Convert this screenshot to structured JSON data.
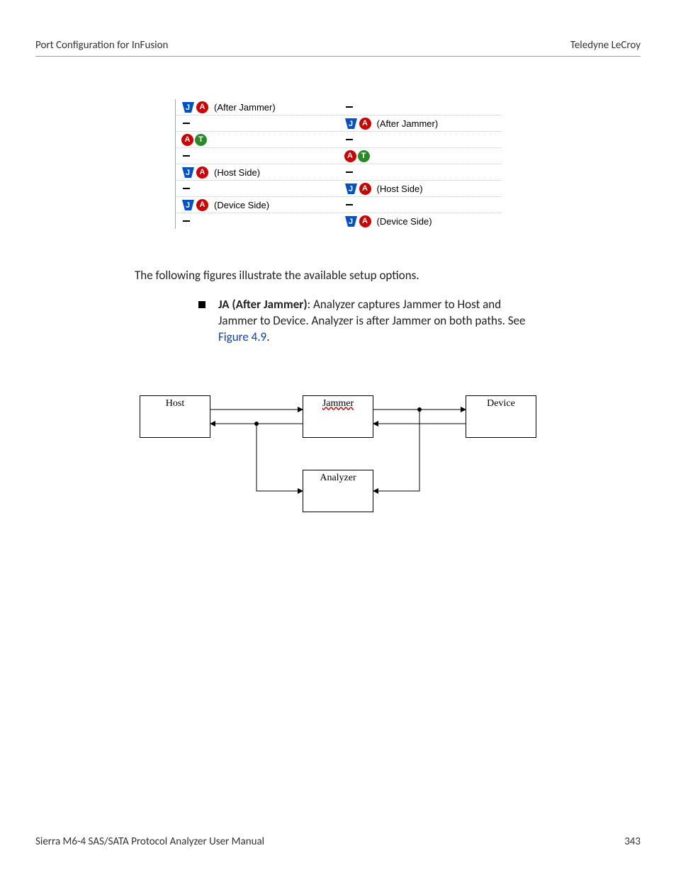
{
  "header": {
    "left": "Port Configuration for InFusion",
    "right": "Teledyne LeCroy"
  },
  "options": {
    "after_jammer": "(After Jammer)",
    "host_side": "(Host Side)",
    "device_side": "(Device Side)"
  },
  "paragraph": "The following figures illustrate the available setup options.",
  "bullet": {
    "lead": "JA (After Jammer)",
    "rest": ": Analyzer captures Jammer to Host and Jammer to Device. Analyzer is after Jammer on both paths. See ",
    "link": "Figure 4.9",
    "tail": "."
  },
  "diagram": {
    "host": "Host",
    "jammer": "Jammer",
    "device": "Device",
    "analyzer": "Analyzer"
  },
  "footer": {
    "left": "Sierra M6-4 SAS/SATA Protocol Analyzer User Manual",
    "page": "343"
  }
}
